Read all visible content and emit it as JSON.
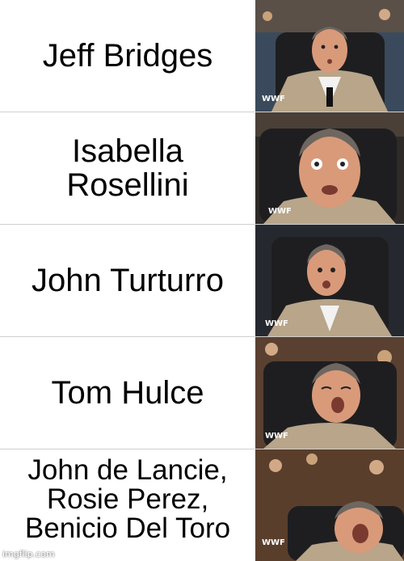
{
  "meme": {
    "panels": [
      {
        "caption": "Jeff Bridges",
        "reaction": "mild-surprise-icon"
      },
      {
        "caption": "Isabella\nRosellini",
        "reaction": "wide-eyed-icon"
      },
      {
        "caption": "John Turturro",
        "reaction": "excited-icon"
      },
      {
        "caption": "Tom Hulce",
        "reaction": "head-back-icon"
      },
      {
        "caption": "John de Lancie,\nRosie Perez,\nBenicio Del Toro",
        "reaction": "ecstatic-icon"
      }
    ],
    "logo": "WWF",
    "watermark": "imgflip.com"
  },
  "colors": {
    "background": "#ffffff",
    "text": "#000000",
    "divider": "#cfcfcf",
    "suit": "#b8a58a",
    "skin": "#d99a7a",
    "hair": "#6e6660",
    "chair": "#1e1e20"
  }
}
